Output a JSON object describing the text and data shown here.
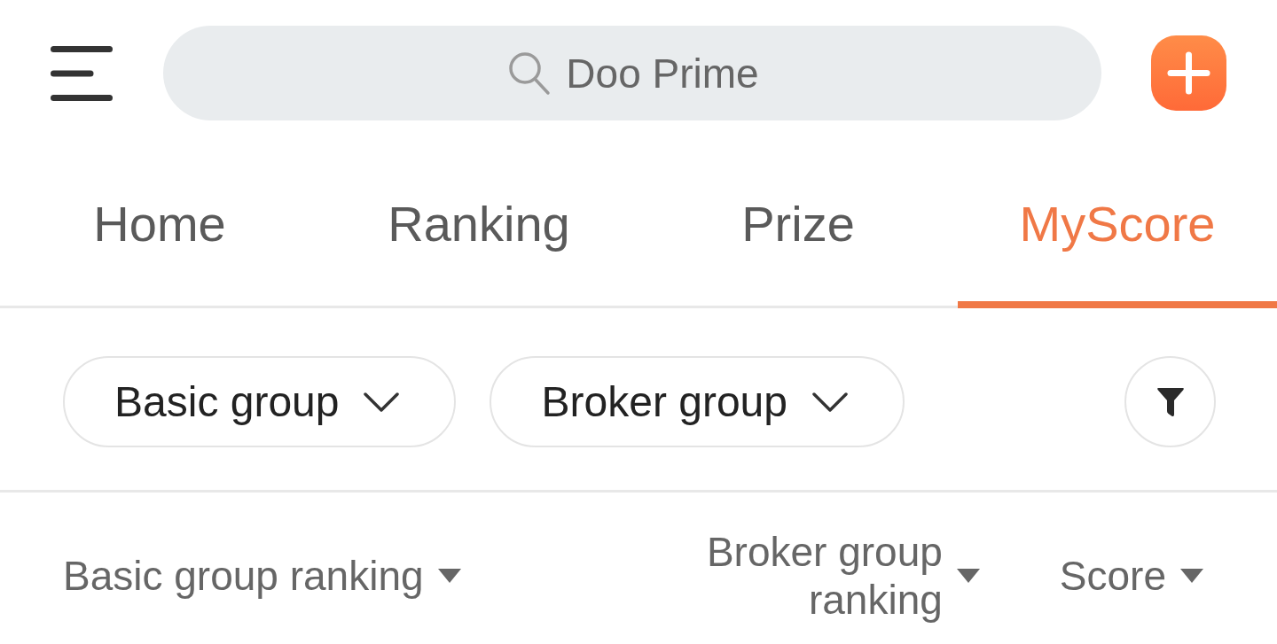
{
  "search": {
    "placeholder": "Doo Prime"
  },
  "tabs": [
    {
      "label": "Home",
      "selected": false
    },
    {
      "label": "Ranking",
      "selected": false
    },
    {
      "label": "Prize",
      "selected": false
    },
    {
      "label": "MyScore",
      "selected": true
    }
  ],
  "filters": [
    {
      "label": "Basic group"
    },
    {
      "label": "Broker group"
    }
  ],
  "columns": [
    {
      "label": "Basic group ranking"
    },
    {
      "label": "Broker group ranking"
    },
    {
      "label": "Score"
    }
  ]
}
